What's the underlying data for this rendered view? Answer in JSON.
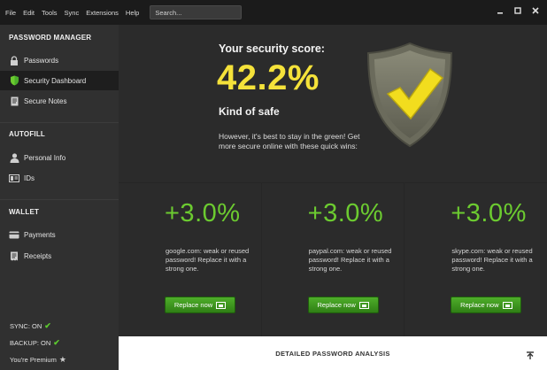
{
  "menu": [
    "File",
    "Edit",
    "Tools",
    "Sync",
    "Extensions",
    "Help"
  ],
  "search": {
    "placeholder": "Search..."
  },
  "sidebar": {
    "password_manager": {
      "heading": "PASSWORD MANAGER",
      "items": [
        {
          "label": "Passwords",
          "icon": "lock-icon"
        },
        {
          "label": "Security Dashboard",
          "icon": "shield-icon",
          "active": true
        },
        {
          "label": "Secure Notes",
          "icon": "note-icon"
        }
      ]
    },
    "autofill": {
      "heading": "AUTOFILL",
      "items": [
        {
          "label": "Personal Info",
          "icon": "person-icon"
        },
        {
          "label": "IDs",
          "icon": "id-card-icon"
        }
      ]
    },
    "wallet": {
      "heading": "WALLET",
      "items": [
        {
          "label": "Payments",
          "icon": "credit-card-icon"
        },
        {
          "label": "Receipts",
          "icon": "receipt-icon"
        }
      ]
    },
    "footer": {
      "sync": "SYNC: ON",
      "backup": "BACKUP: ON",
      "premium": "You're Premium"
    }
  },
  "score": {
    "title": "Your security score:",
    "value": "42.2%",
    "level": "Kind of safe",
    "message": "However, it's best to stay in the green! Get more secure online with these quick wins:"
  },
  "quick_wins": [
    {
      "percent": "+3.0%",
      "description": "google.com: weak or reused password! Replace it with a strong one.",
      "button": "Replace now"
    },
    {
      "percent": "+3.0%",
      "description": "paypal.com: weak or reused password! Replace it with a strong one.",
      "button": "Replace now"
    },
    {
      "percent": "+3.0%",
      "description": "skype.com: weak or reused password! Replace it with a strong one.",
      "button": "Replace now"
    }
  ],
  "analysis": {
    "label": "DETAILED PASSWORD ANALYSIS"
  },
  "colors": {
    "accent_green": "#6ccb30",
    "score_yellow": "#f5e23a",
    "active_item_bg": "#1e1e1e"
  }
}
